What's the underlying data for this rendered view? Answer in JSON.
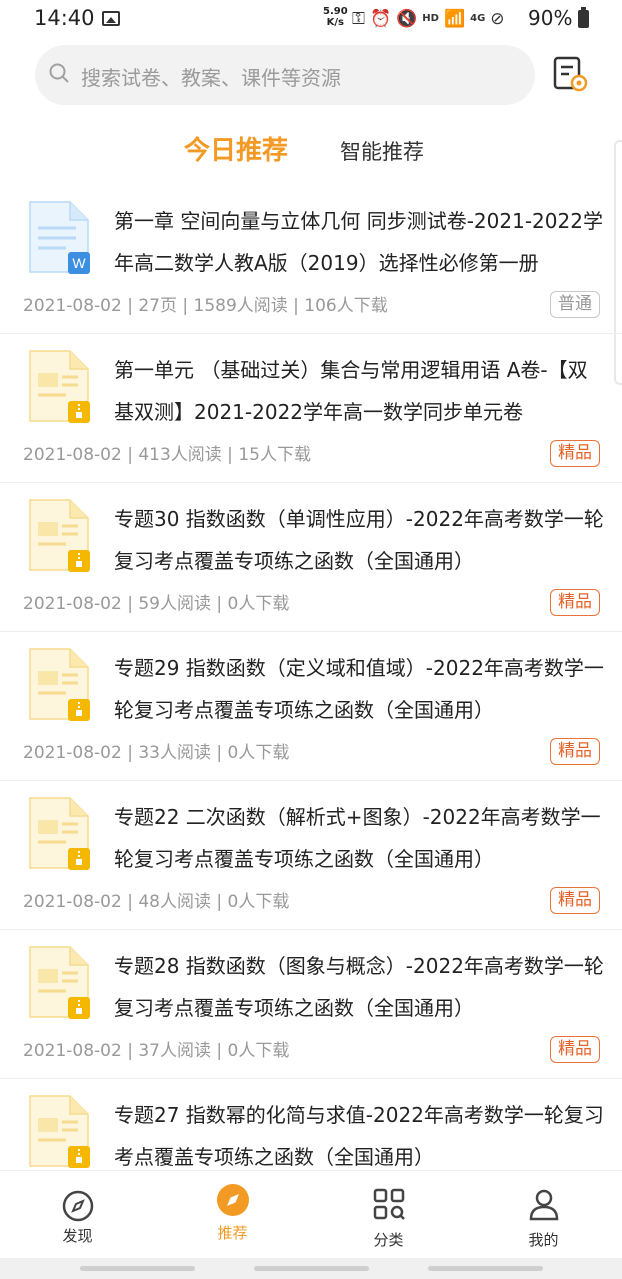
{
  "status_bar": {
    "time": "14:40",
    "speed_value": "5.90",
    "speed_unit": "K/s",
    "hd": "HD",
    "network": "4G",
    "battery": "90%"
  },
  "search": {
    "placeholder": "搜索试卷、教案、课件等资源"
  },
  "tabs": [
    {
      "label": "今日推荐",
      "active": true
    },
    {
      "label": "智能推荐",
      "active": false
    }
  ],
  "items": [
    {
      "title": "第一章  空间向量与立体几何 同步测试卷-2021-2022学年高二数学人教A版（2019）选择性必修第一册",
      "meta": "2021-08-02 | 27页 | 1589人阅读 | 106人下载",
      "badge": "普通",
      "badge_type": "normal",
      "thumb": "word"
    },
    {
      "title": "第一单元  （基础过关）集合与常用逻辑用语 A卷-【双基双测】2021-2022学年高一数学同步单元卷",
      "meta": "2021-08-02 | 413人阅读 | 15人下载",
      "badge": "精品",
      "badge_type": "premium",
      "thumb": "zip"
    },
    {
      "title": "专题30  指数函数（单调性应用）-2022年高考数学一轮复习考点覆盖专项练之函数（全国通用）",
      "meta": "2021-08-02 | 59人阅读 | 0人下载",
      "badge": "精品",
      "badge_type": "premium",
      "thumb": "zip"
    },
    {
      "title": "专题29  指数函数（定义域和值域）-2022年高考数学一轮复习考点覆盖专项练之函数（全国通用）",
      "meta": "2021-08-02 | 33人阅读 | 0人下载",
      "badge": "精品",
      "badge_type": "premium",
      "thumb": "zip"
    },
    {
      "title": "专题22  二次函数（解析式+图象）-2022年高考数学一轮复习考点覆盖专项练之函数（全国通用）",
      "meta": "2021-08-02 | 48人阅读 | 0人下载",
      "badge": "精品",
      "badge_type": "premium",
      "thumb": "zip"
    },
    {
      "title": "专题28  指数函数（图象与概念）-2022年高考数学一轮复习考点覆盖专项练之函数（全国通用）",
      "meta": "2021-08-02 | 37人阅读 | 0人下载",
      "badge": "精品",
      "badge_type": "premium",
      "thumb": "zip"
    },
    {
      "title": "专题27  指数幂的化简与求值-2022年高考数学一轮复习考点覆盖专项练之函数（全国通用）",
      "meta": "",
      "badge": "",
      "badge_type": "premium",
      "thumb": "zip"
    }
  ],
  "nav": [
    {
      "label": "发现",
      "icon": "compass-icon",
      "active": false
    },
    {
      "label": "推荐",
      "icon": "recommend-icon",
      "active": true
    },
    {
      "label": "分类",
      "icon": "category-icon",
      "active": false
    },
    {
      "label": "我的",
      "icon": "profile-icon",
      "active": false
    }
  ],
  "colors": {
    "accent": "#f39a24",
    "premium": "#e3642a",
    "word_blue": "#3b8fe0",
    "zip_yellow": "#f5b800"
  }
}
